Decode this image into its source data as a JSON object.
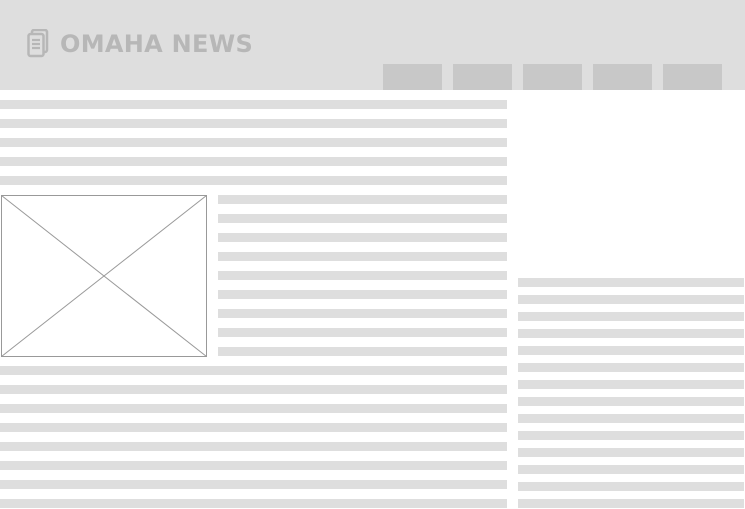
{
  "header": {
    "logo_text": "OMAHA NEWS",
    "logo_icon": "newspaper-icon",
    "nav_tab_count": 5
  },
  "main": {
    "image_placeholder": "image-placeholder"
  },
  "colors": {
    "header_bg": "#dedede",
    "logo_text": "#b7b7b7",
    "nav_tab": "#c8c8c8",
    "placeholder_line": "#dedede",
    "page_bg": "#ffffff"
  }
}
